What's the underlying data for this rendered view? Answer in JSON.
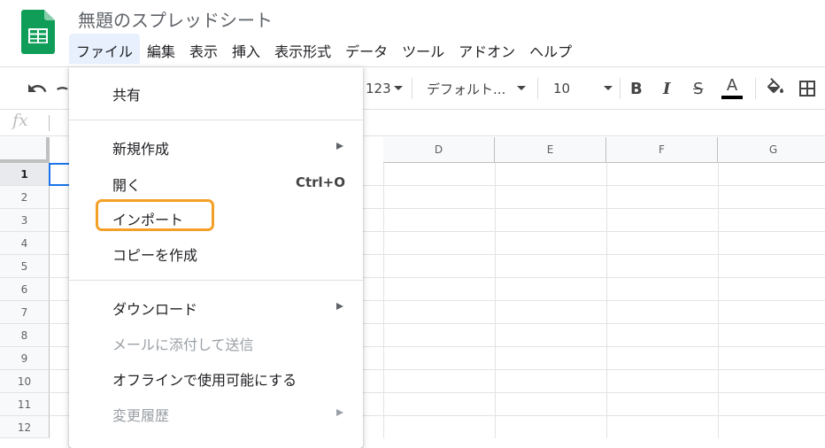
{
  "app": {
    "title": "無題のスプレッドシート",
    "brand_color": "#0f9d58"
  },
  "menubar": {
    "items": [
      {
        "label": "ファイル",
        "active": true
      },
      {
        "label": "編集"
      },
      {
        "label": "表示"
      },
      {
        "label": "挿入"
      },
      {
        "label": "表示形式"
      },
      {
        "label": "データ"
      },
      {
        "label": "ツール"
      },
      {
        "label": "アドオン"
      },
      {
        "label": "ヘルプ"
      }
    ]
  },
  "toolbar": {
    "number_format": "123",
    "font_name": "デフォルト...",
    "font_size": "10",
    "bold": "B",
    "italic": "I",
    "strike": "S",
    "text_color": "A",
    "text_color_value": "#000000"
  },
  "formula_bar": {
    "fx_label": "fx"
  },
  "grid": {
    "columns": [
      "D",
      "E",
      "F",
      "G"
    ],
    "rows": [
      "1",
      "2",
      "3",
      "4",
      "5",
      "6",
      "7",
      "8",
      "9",
      "10",
      "11",
      "12"
    ],
    "selected_row": "1"
  },
  "file_menu": {
    "items": [
      {
        "label": "共有"
      },
      {
        "label": "新規作成",
        "submenu": true
      },
      {
        "label": "開く",
        "shortcut": "Ctrl+O"
      },
      {
        "label": "インポート",
        "highlighted": true
      },
      {
        "label": "コピーを作成"
      },
      {
        "label": "ダウンロード",
        "submenu": true
      },
      {
        "label": "メールに添付して送信",
        "disabled": true
      },
      {
        "label": "オフラインで使用可能にする"
      },
      {
        "label": "変更履歴",
        "submenu": true,
        "disabled": true
      }
    ],
    "highlight_color": "#f4a028"
  }
}
